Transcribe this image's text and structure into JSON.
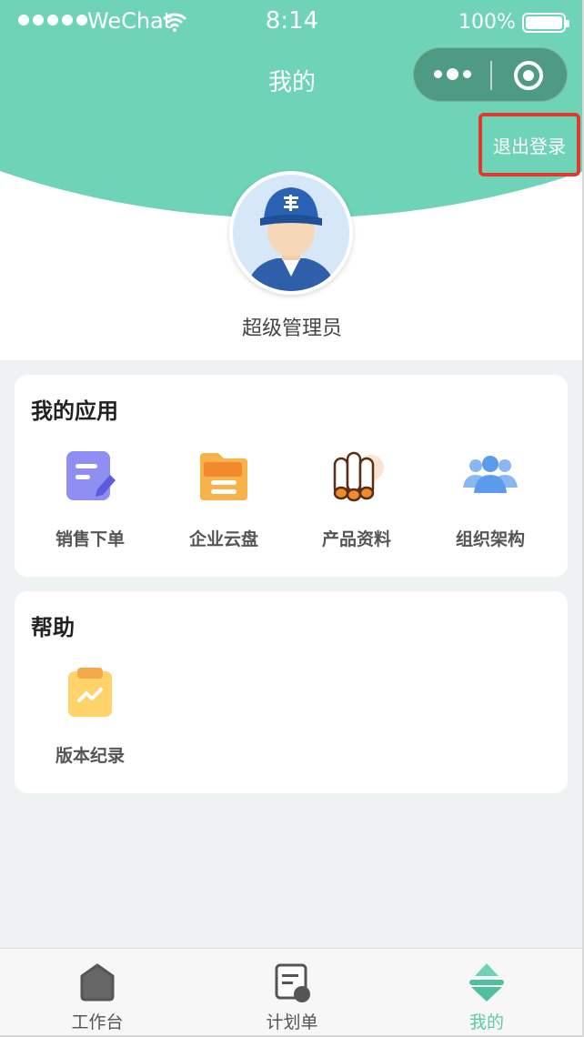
{
  "status_bar": {
    "carrier": "WeChat",
    "time": "8:14",
    "battery": "100%"
  },
  "nav": {
    "title": "我的"
  },
  "logout_label": "退出登录",
  "profile": {
    "username": "超级管理员"
  },
  "apps": {
    "title": "我的应用",
    "items": [
      {
        "label": "销售下单",
        "icon": "sales-order-icon"
      },
      {
        "label": "企业云盘",
        "icon": "cloud-drive-icon"
      },
      {
        "label": "产品资料",
        "icon": "product-docs-icon"
      },
      {
        "label": "组织架构",
        "icon": "org-structure-icon"
      }
    ]
  },
  "help": {
    "title": "帮助",
    "items": [
      {
        "label": "版本纪录",
        "icon": "version-log-icon"
      }
    ]
  },
  "tabbar": {
    "items": [
      {
        "label": "工作台",
        "icon": "workbench-icon",
        "active": false
      },
      {
        "label": "计划单",
        "icon": "plan-icon",
        "active": false
      },
      {
        "label": "我的",
        "icon": "profile-icon",
        "active": true
      }
    ]
  },
  "colors": {
    "accent": "#6fd3b7",
    "logout_outline": "#e0392f",
    "tab_active": "#5fc9a8"
  }
}
